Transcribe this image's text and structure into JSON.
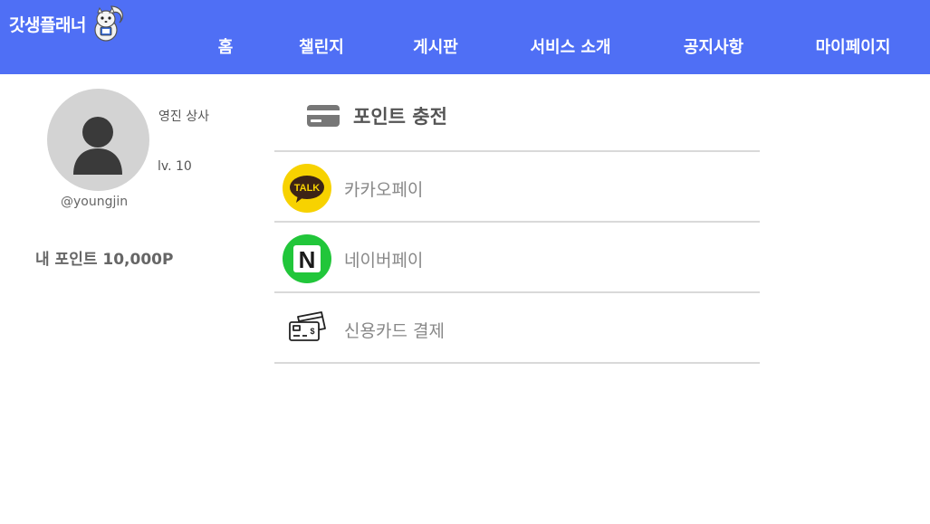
{
  "app": {
    "logo_text": "갓생플래너"
  },
  "nav": {
    "items": [
      {
        "label": "홈"
      },
      {
        "label": "챌린지"
      },
      {
        "label": "게시판"
      },
      {
        "label": "서비스 소개"
      },
      {
        "label": "공지사항"
      },
      {
        "label": "마이페이지"
      }
    ]
  },
  "profile": {
    "name": "영진 상사",
    "level": "lv. 10",
    "handle": "@youngjin",
    "points": "내 포인트 10,000P"
  },
  "charge": {
    "title": "포인트 충전",
    "icon": "credit-card-icon",
    "options": [
      {
        "label": "카카오페이",
        "icon": "kakaotalk-icon",
        "icon_text": "TALK"
      },
      {
        "label": "네이버페이",
        "icon": "naver-icon",
        "icon_text": "N"
      },
      {
        "label": "신용카드 결제",
        "icon": "credit-cards-icon"
      }
    ]
  },
  "colors": {
    "header": "#4f6ff5",
    "kakao": "#f7d200",
    "naver": "#21c63a",
    "divider": "#d9d9d9"
  }
}
